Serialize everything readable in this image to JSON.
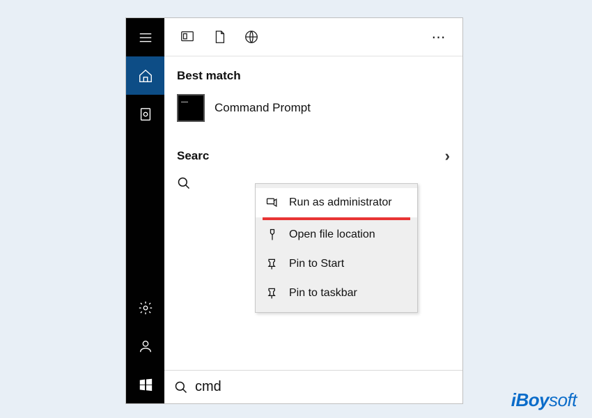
{
  "header": {
    "best_match": "Best match",
    "result_label": "Command Prompt",
    "search_truncated": "Searc",
    "more_label": "⋯"
  },
  "context": {
    "run_admin": "Run as administrator",
    "open_location": "Open file location",
    "pin_start": "Pin to Start",
    "pin_taskbar": "Pin to taskbar"
  },
  "search": {
    "value": "cmd"
  },
  "watermark": {
    "brand_i": "i",
    "brand_boy": "Boy",
    "brand_soft": "soft"
  }
}
